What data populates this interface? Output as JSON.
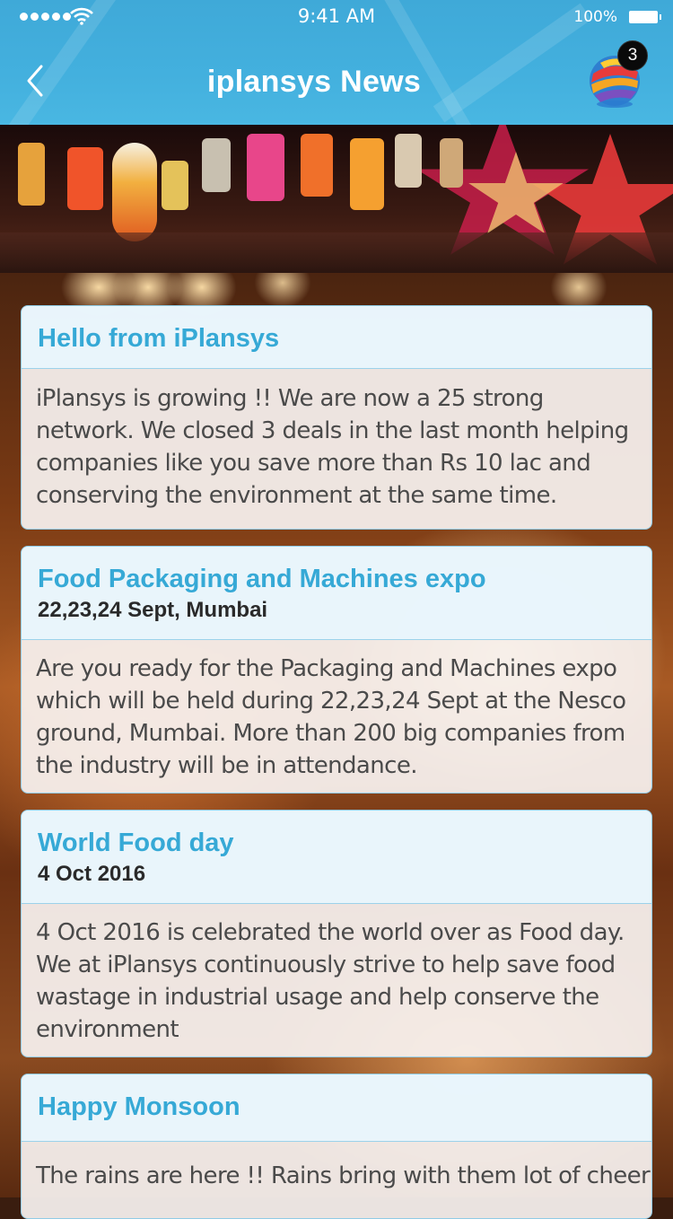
{
  "status_bar": {
    "time": "9:41 AM",
    "battery_percent": "100%"
  },
  "header": {
    "title": "iplansys News",
    "notification_count": "3"
  },
  "news": [
    {
      "title": "Hello from iPlansys",
      "subtitle": "",
      "body": "iPlansys is growing !! We are now a 25 strong network. We closed 3 deals in the last month helping companies like you save more than Rs 10 lac and conserving the environment at the same time."
    },
    {
      "title": "Food Packaging and Machines expo",
      "subtitle": "22,23,24 Sept, Mumbai",
      "body": "Are you ready for the Packaging and Machines expo which will be held during 22,23,24 Sept at the Nesco ground, Mumbai. More than 200 big companies from the industry will be in attendance."
    },
    {
      "title": "World Food day",
      "subtitle": "4 Oct 2016",
      "body": "4 Oct 2016 is celebrated the world over as Food day. We at iPlansys continuously strive to help save food wastage in industrial usage and help conserve the environment"
    },
    {
      "title": "Happy Monsoon",
      "subtitle": "",
      "body": "The rains are here !! Rains bring with them lot of cheer"
    }
  ],
  "colors": {
    "header_bg": "#43b0de",
    "card_title": "#36a9d6",
    "card_border": "#8fcbe6"
  },
  "icons": {
    "back": "chevron-left-icon",
    "logo": "globe-logo-icon",
    "wifi": "wifi-icon",
    "signal": "signal-dots-icon",
    "battery": "battery-icon"
  }
}
